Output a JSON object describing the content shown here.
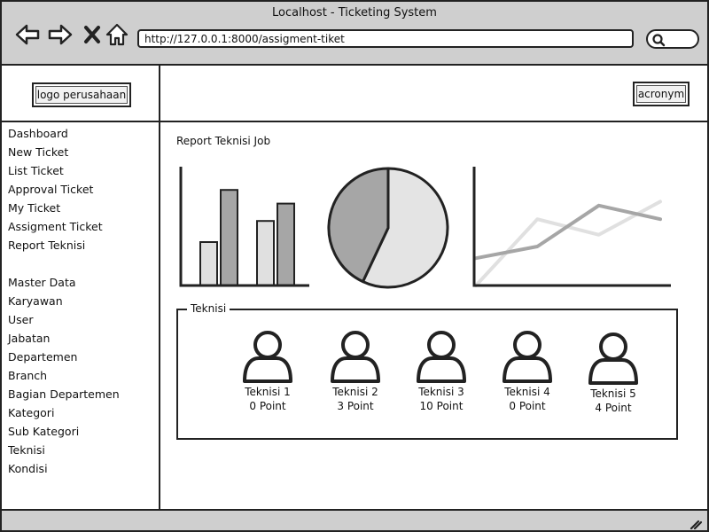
{
  "window": {
    "title": "Localhost - Ticketing System",
    "url": "http://127.0.0.1:8000/assigment-tiket"
  },
  "nav_icons": [
    "back-arrow-icon",
    "forward-arrow-icon",
    "close-x-icon",
    "home-icon"
  ],
  "header": {
    "logo_label": "logo perusahaan",
    "acronym_label": "acronym"
  },
  "sidebar": {
    "items": [
      "Dashboard",
      "New Ticket",
      "List Ticket",
      "Approval Ticket",
      "My Ticket",
      "Assigment Ticket",
      "Report Teknisi"
    ],
    "master_items": [
      "Master Data",
      "Karyawan",
      "User",
      "Jabatan",
      "Departemen",
      "Branch",
      "Bagian Departemen",
      "Kategori",
      "Sub Kategori",
      "Teknisi",
      "Kondisi"
    ]
  },
  "main": {
    "report_title": "Report Teknisi Job",
    "teknisi_legend": "Teknisi",
    "teknisi": [
      {
        "name": "Teknisi 1",
        "point": "0 Point"
      },
      {
        "name": "Teknisi 2",
        "point": "3 Point"
      },
      {
        "name": "Teknisi 3",
        "point": "10 Point"
      },
      {
        "name": "Teknisi 4",
        "point": "0 Point"
      },
      {
        "name": "Teknisi 5",
        "point": "4 Point"
      }
    ]
  },
  "chart_data": [
    {
      "type": "bar",
      "categories": [
        "",
        ""
      ],
      "series": [
        {
          "values": [
            0.35,
            0.52
          ],
          "color": "#e0e0e0"
        },
        {
          "values": [
            0.77,
            0.66
          ],
          "color": "#a6a6a6"
        }
      ],
      "ylim": [
        0,
        1
      ]
    },
    {
      "type": "pie",
      "values": [
        57,
        43
      ],
      "colors": [
        "#e4e4e4",
        "#a6a6a6"
      ]
    },
    {
      "type": "line",
      "x": [
        0,
        1,
        2,
        3
      ],
      "series": [
        {
          "values": [
            0.0,
            0.68,
            0.52,
            0.86
          ],
          "color": "#e0e0e0"
        },
        {
          "values": [
            0.28,
            0.4,
            0.82,
            0.68
          ],
          "color": "#a6a6a6"
        }
      ],
      "ylim": [
        0,
        1
      ]
    }
  ],
  "colors": {
    "chrome": "#cfcfcf",
    "stroke": "#222222",
    "light_fill": "#e0e0e0",
    "dark_fill": "#a6a6a6"
  }
}
